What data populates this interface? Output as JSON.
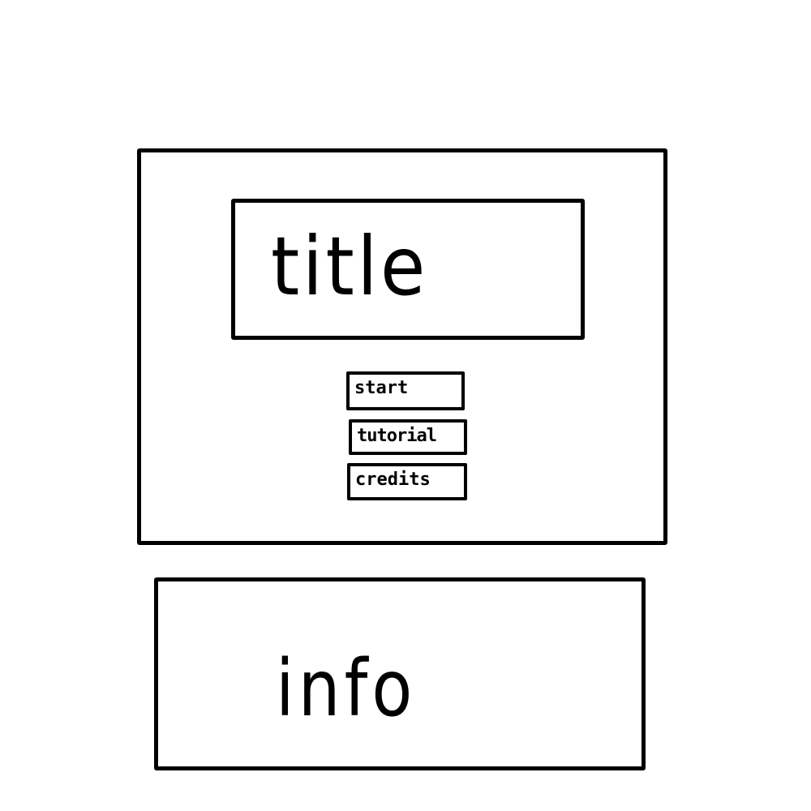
{
  "main_panel": {
    "title": "title",
    "menu": {
      "start_label": "start",
      "tutorial_label": "tutorial",
      "credits_label": "credits"
    }
  },
  "info_panel": {
    "text": "info"
  },
  "colors": {
    "stroke": "#000000",
    "background": "#ffffff"
  }
}
